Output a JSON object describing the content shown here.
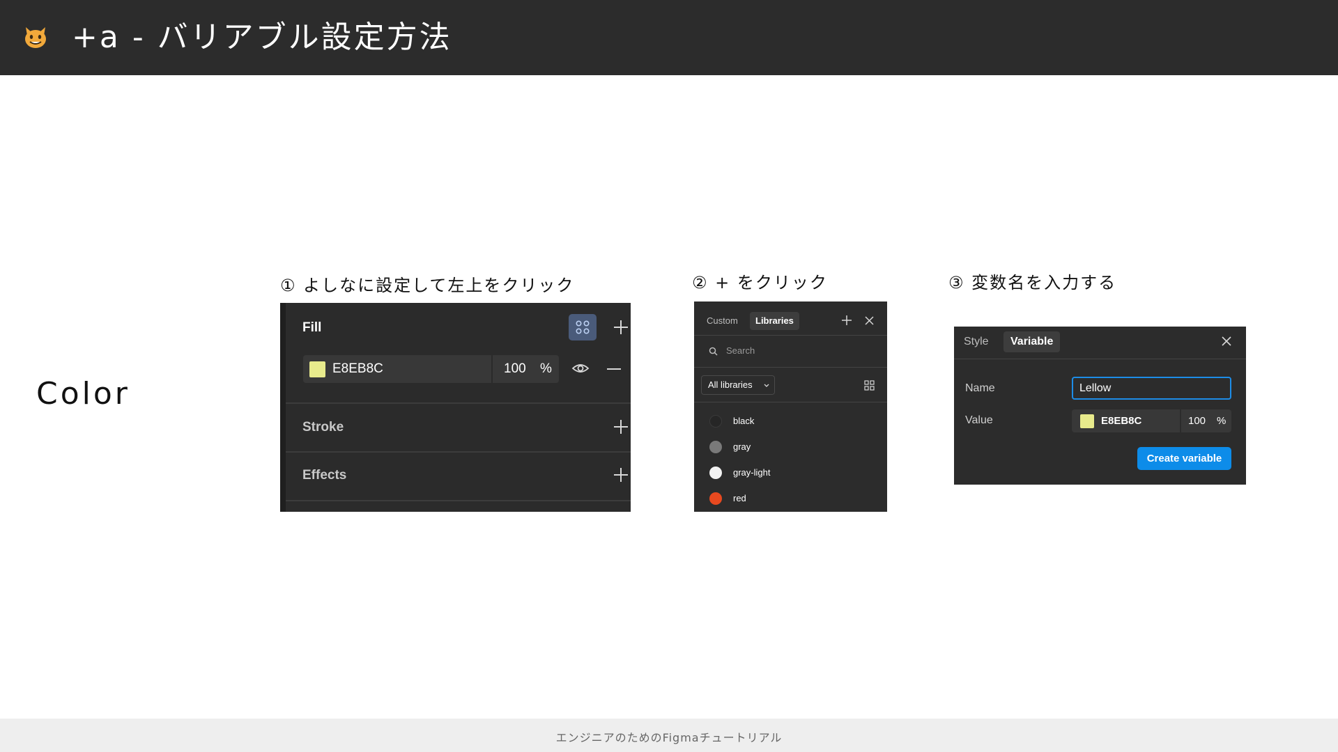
{
  "header": {
    "icon": "cat-face-emoji-icon",
    "title": "+a - バリアブル設定方法"
  },
  "section": {
    "label": "Color"
  },
  "steps": {
    "step1": "① よしなに設定して左上をクリック",
    "step2": "② + をクリック",
    "step3": "③ 変数名を入力する"
  },
  "fill_panel": {
    "fill_title": "Fill",
    "hex_value": "E8EB8C",
    "opacity": "100",
    "percent": "%",
    "stroke_title": "Stroke",
    "effects_title": "Effects",
    "swatch_color": "#E8EB8C",
    "style_button_icon": "grid-dots-icon"
  },
  "libraries_panel": {
    "tabs": [
      "Custom",
      "Libraries"
    ],
    "search_placeholder": "Search",
    "dropdown_label": "All libraries",
    "items": [
      {
        "name": "black",
        "color": "#262626"
      },
      {
        "name": "gray",
        "color": "#7a7a7a"
      },
      {
        "name": "gray-light",
        "color": "#f2f2f2"
      },
      {
        "name": "red",
        "color": "#e8491f"
      }
    ]
  },
  "variable_panel": {
    "tabs": [
      "Style",
      "Variable"
    ],
    "name_label": "Name",
    "name_value": "Lellow",
    "value_label": "Value",
    "hex_value": "E8EB8C",
    "opacity": "100",
    "percent": "%",
    "create_button": "Create variable",
    "accent_color": "#0d8ce9"
  },
  "footer": {
    "text": "エンジニアのためのFigmaチュートリアル"
  }
}
